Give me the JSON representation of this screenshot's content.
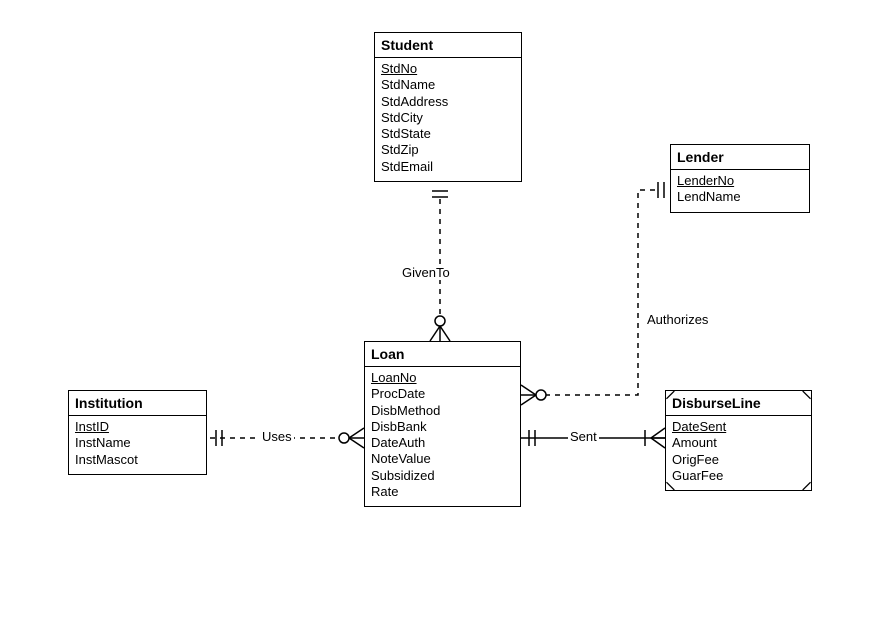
{
  "entities": {
    "student": {
      "title": "Student",
      "attrs": [
        "StdNo",
        "StdName",
        "StdAddress",
        "StdCity",
        "StdState",
        "StdZip",
        "StdEmail"
      ],
      "keys": [
        "StdNo"
      ]
    },
    "lender": {
      "title": "Lender",
      "attrs": [
        "LenderNo",
        "LendName"
      ],
      "keys": [
        "LenderNo"
      ]
    },
    "loan": {
      "title": "Loan",
      "attrs": [
        "LoanNo",
        "ProcDate",
        "DisbMethod",
        "DisbBank",
        "DateAuth",
        "NoteValue",
        "Subsidized",
        "Rate"
      ],
      "keys": [
        "LoanNo"
      ]
    },
    "institution": {
      "title": "Institution",
      "attrs": [
        "InstID",
        "InstName",
        "InstMascot"
      ],
      "keys": [
        "InstID"
      ]
    },
    "disburseline": {
      "title": "DisburseLine",
      "attrs": [
        "DateSent",
        "Amount",
        "OrigFee",
        "GuarFee"
      ],
      "keys": [
        "DateSent"
      ],
      "weak": true
    }
  },
  "relationships": {
    "givenTo": "GivenTo",
    "authorizes": "Authorizes",
    "uses": "Uses",
    "sent": "Sent"
  }
}
